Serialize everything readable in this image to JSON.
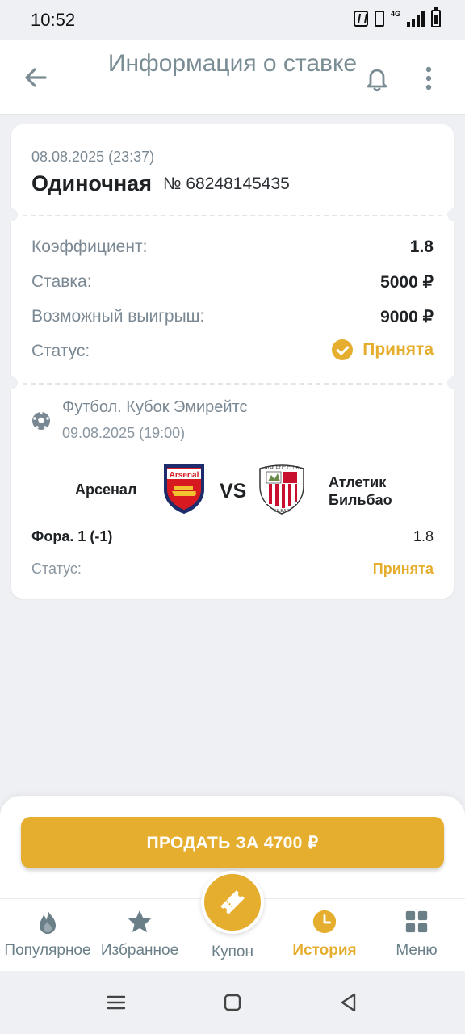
{
  "status_bar": {
    "time": "10:52",
    "network": "4G"
  },
  "header": {
    "title": "Информация о ставке"
  },
  "bet": {
    "datetime": "08.08.2025 (23:37)",
    "type": "Одиночная",
    "number": "№ 68248145435",
    "rows": [
      {
        "label": "Коэффициент:",
        "value": "1.8"
      },
      {
        "label": "Ставка:",
        "value": "5000 ₽"
      },
      {
        "label": "Возможный выигрыш:",
        "value": "9000 ₽"
      }
    ],
    "status_label": "Статус:",
    "status_value": "Принята"
  },
  "event": {
    "name": "Футбол. Кубок Эмирейтс",
    "datetime": "09.08.2025 (19:00)",
    "home_team": "Арсенал",
    "vs": "VS",
    "away_team_line1": "Атлетик",
    "away_team_line2": "Бильбао",
    "home_logo_text": "Arsenal",
    "away_logo_text": "ATHLETIC CLUB",
    "away_logo_bottom": "BILBAO",
    "market": "Фора. 1 (-1)",
    "market_odds": "1.8",
    "selection_status_label": "Статус:",
    "selection_status_value": "Принята"
  },
  "sell": {
    "label": "ПРОДАТЬ ЗА 4700 ₽"
  },
  "nav": {
    "popular": "Популярное",
    "favorites": "Избранное",
    "coupon": "Купон",
    "history": "История",
    "menu": "Меню"
  },
  "colors": {
    "accent": "#e6ae2e",
    "muted": "#7a8893",
    "title": "#7a8d94",
    "nav": "#6b7f88"
  },
  "icons": {
    "back": "arrow-left-icon",
    "bell": "bell-icon",
    "menu": "more-vertical-icon",
    "status": "check-circle-icon",
    "sport": "soccer-ball-icon",
    "popular": "flame-icon",
    "favorites": "star-icon",
    "coupon": "ticket-icon",
    "history": "clock-icon",
    "menu_tab": "grid-icon"
  }
}
